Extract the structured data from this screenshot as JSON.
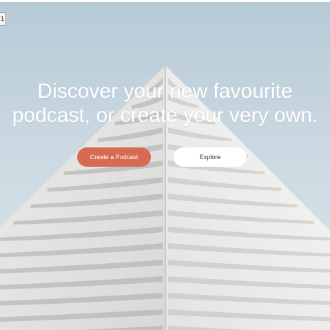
{
  "page": {
    "page_number": "1"
  },
  "hero": {
    "background_image": "building-architecture-photo",
    "headline_line1": "Discover your new favourite",
    "headline_line2": "podcast, or create your very own."
  },
  "actions": {
    "create_label": "Create a Podcast",
    "explore_label": "Explore"
  },
  "colors": {
    "create_button": "#d66a52",
    "explore_button": "#ffffff",
    "headline_text": "#ffffff",
    "sky": "#c9d8e0"
  }
}
